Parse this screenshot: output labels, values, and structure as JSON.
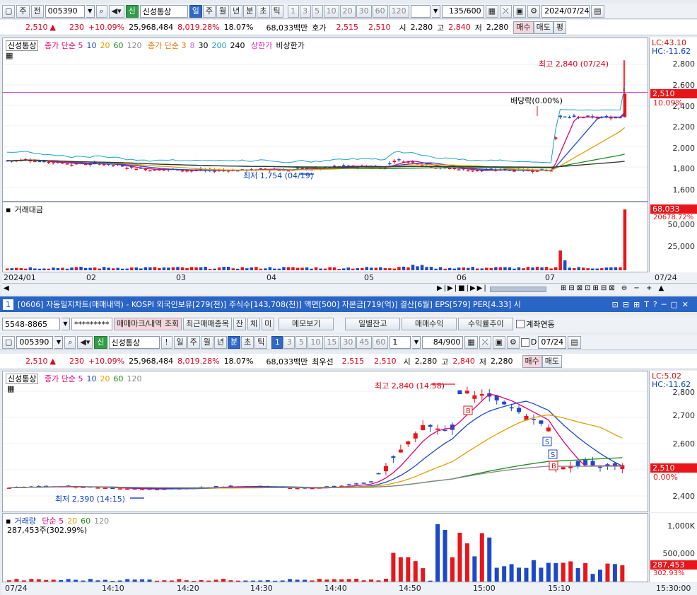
{
  "top": {
    "toolbar": {
      "type": "주",
      "prev": "전",
      "code": "005390",
      "badge": "신",
      "name": "신성통상",
      "periods": [
        "일",
        "주",
        "월",
        "년",
        "분",
        "초",
        "틱"
      ],
      "active_period": "일",
      "nums": [
        "1",
        "3",
        "5",
        "10",
        "20",
        "30",
        "60",
        "120"
      ],
      "count": "135",
      "count_total": "/600",
      "date": "2024/07/24"
    },
    "quote": {
      "price": "2,510",
      "arrow": "▲",
      "change": "230",
      "pct": "+10.09%",
      "volume": "25,968,484",
      "vol_ratio": "8,019.28%",
      "turnover": "18.07%",
      "amount": "68,033백만",
      "hoga_label": "호가",
      "hoga1": "2,515",
      "hoga2": "2,510",
      "open_label": "시",
      "open": "2,280",
      "high_label": "고",
      "high": "2,840",
      "low_label": "저",
      "low": "2,280",
      "buy": "매수",
      "sell": "매도",
      "avg": "평"
    },
    "legend": {
      "name": "신성통상",
      "ma1": "종가 단순 5",
      "ma1b": "10",
      "ma1c": "20",
      "ma1d": "60",
      "ma1e": "120",
      "ma2": "종가 단순 3",
      "ma2b": "8",
      "ma2c": "30",
      "ma2d": "200",
      "ma2e": "240",
      "limit_up": "상한가",
      "vi": "비상한가"
    },
    "annot": {
      "high": "최고 2,840 (07/24)",
      "low": "최저 1,754 (04/19)",
      "dividend": "배당락(0.00%)"
    },
    "axis": {
      "lc": "LC:43.10",
      "hc": "HC:-11.62",
      "ticks": [
        "2,800",
        "2,600",
        "2,400",
        "2,200",
        "2,000",
        "1,800",
        "1,600"
      ],
      "price_tag": "2,510",
      "pct_tag": "10.09%"
    },
    "vol": {
      "title": "거래대금",
      "tag": "68,033",
      "ratio": "20678.72%",
      "ticks": [
        "50,000",
        "25,000"
      ]
    },
    "xaxis": [
      "2024/01",
      "02",
      "03",
      "04",
      "05",
      "06",
      "07",
      "07/24"
    ],
    "colors": {
      "up": "#e8161a",
      "down": "#1c49c9",
      "limit": "#d12fbd"
    }
  },
  "window": {
    "title": "[0606] 자동일지차트(매매내역) - KOSPI 외국인보유[279(천)] 주식수[143,708(천)] 액면[500] 자본금[719(억)] 결산[6월] EPS[579] PER[4.33] 시"
  },
  "bottom": {
    "account": {
      "acct": "5548-8865",
      "pw": "*********",
      "btn1": "매매마크/내역 조회",
      "btn2": "최근매매종목",
      "b3": "잔",
      "b4": "체",
      "b5": "미",
      "memo": "메모보기",
      "daily": "일별잔고",
      "profit": "매매수익",
      "rate": "수익률추이",
      "link": "계좌연동"
    },
    "toolbar": {
      "code": "005390",
      "badge": "신",
      "name": "신성통상",
      "bang": "!",
      "periods": [
        "일",
        "주",
        "월",
        "년",
        "분",
        "초",
        "틱"
      ],
      "active_period": "분",
      "day_val": "1",
      "nums": [
        "1",
        "3",
        "5",
        "10",
        "15",
        "30",
        "45",
        "60"
      ],
      "unit": "1",
      "count": "84",
      "count_total": "/900",
      "d_label": "D",
      "date": "07/24"
    },
    "quote": {
      "price": "2,510",
      "arrow": "▲",
      "change": "230",
      "pct": "+10.09%",
      "volume": "25,968,484",
      "vol_ratio": "8,019.28%",
      "turnover": "18.07%",
      "amount": "68,033백만",
      "hoga_label": "최우선",
      "hoga1": "2,515",
      "hoga2": "2,510",
      "open_label": "시",
      "open": "2,280",
      "high_label": "고",
      "high": "2,840",
      "low_label": "저",
      "low": "2,280",
      "buy": "매수",
      "sell": "매도"
    },
    "legend": {
      "name": "신성통상",
      "ma1": "종가 단순 5",
      "b": "10",
      "c": "20",
      "d": "60",
      "e": "120"
    },
    "annot": {
      "high": "최고 2,840 (14:58)",
      "low": "최저 2,390 (14:15)"
    },
    "axis": {
      "lc": "LC:5.02",
      "hc": "HC:-11.62",
      "ticks": [
        "2,800",
        "2,700",
        "2,600",
        "2,500",
        "2,400"
      ],
      "price_tag": "2,510",
      "pct_tag": "0.00%"
    },
    "vol": {
      "title": "거래량",
      "ma": "단순 5",
      "b": "20",
      "c": "60",
      "d": "120",
      "sub": "287,453주(302.99%)",
      "tag": "287,453",
      "ratio": "302.93%",
      "ticks": [
        "1,000K",
        "500,000"
      ]
    },
    "xaxis": [
      "07/24",
      "14:10",
      "14:20",
      "14:30",
      "14:40",
      "14:50",
      "15:00",
      "15:10",
      "15:30:00"
    ]
  }
}
